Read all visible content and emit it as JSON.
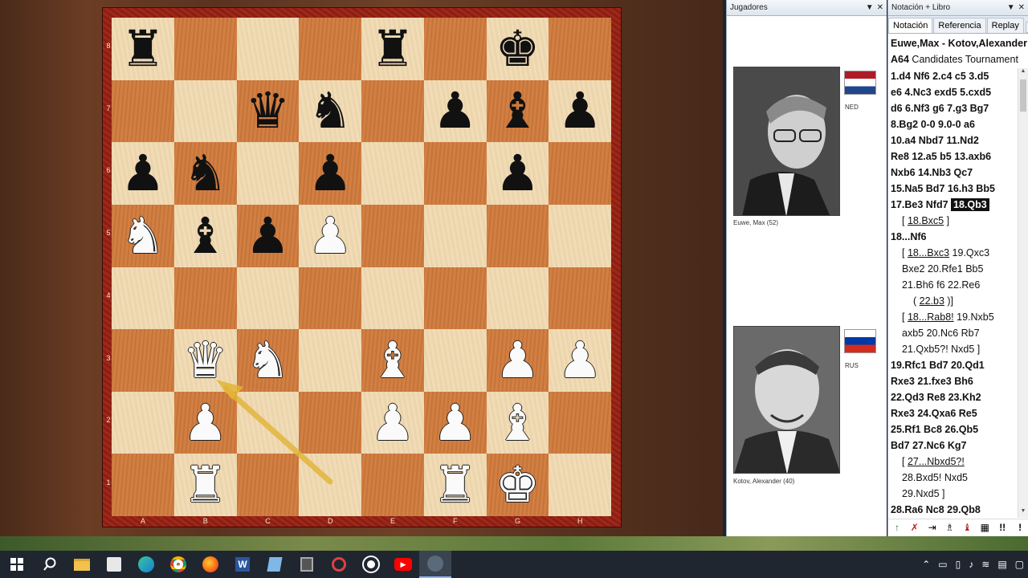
{
  "board": {
    "ranks": [
      "8",
      "7",
      "6",
      "5",
      "4",
      "3",
      "2",
      "1"
    ],
    "files": [
      "A",
      "B",
      "C",
      "D",
      "E",
      "F",
      "G",
      "H"
    ],
    "position": [
      [
        "bR",
        "",
        "",
        "",
        "bR",
        "",
        "bK",
        ""
      ],
      [
        "",
        "",
        "bQ",
        "bN",
        "",
        "bP",
        "bB",
        "bP"
      ],
      [
        "bP",
        "bN",
        "",
        "bP",
        "",
        "",
        "bP",
        ""
      ],
      [
        "wN",
        "bB",
        "bP",
        "wP",
        "",
        "",
        "",
        ""
      ],
      [
        "",
        "",
        "",
        "",
        "",
        "",
        "",
        ""
      ],
      [
        "",
        "wQ",
        "wN",
        "",
        "wB",
        "",
        "wP",
        "wP"
      ],
      [
        "",
        "wP",
        "",
        "",
        "wP",
        "wP",
        "wB",
        ""
      ],
      [
        "",
        "wR",
        "",
        "",
        "",
        "wR",
        "wK",
        ""
      ]
    ],
    "arrow_color": "#e2b436"
  },
  "players_pane": {
    "title": "Jugadores",
    "white": {
      "name": "Euwe, Max  (52)",
      "country": "NED"
    },
    "black": {
      "name": "Kotov, Alexander  (40)",
      "country": "RUS"
    }
  },
  "notation_pane": {
    "title": "Notación + Libro",
    "tabs": [
      "Notación",
      "Referencia",
      "Replay"
    ],
    "header": {
      "players": "Euwe,Max - Kotov,Alexander",
      "eco": "A64",
      "event": "Candidates Tournament"
    },
    "lines": [
      {
        "cls": "main",
        "parts": [
          {
            "t": "1.d4  Nf6  2.c4  c5  3.d5"
          }
        ]
      },
      {
        "cls": "main",
        "parts": [
          {
            "t": "e6  4.Nc3  exd5  5.cxd5"
          }
        ]
      },
      {
        "cls": "main",
        "parts": [
          {
            "t": "d6  6.Nf3  g6  7.g3  Bg7"
          }
        ]
      },
      {
        "cls": "main",
        "parts": [
          {
            "t": "8.Bg2  0-0  9.0-0  a6"
          }
        ]
      },
      {
        "cls": "main",
        "parts": [
          {
            "t": "10.a4  Nbd7  11.Nd2"
          }
        ]
      },
      {
        "cls": "main",
        "parts": [
          {
            "t": "Re8  12.a5  b5  13.axb6"
          }
        ]
      },
      {
        "cls": "main",
        "parts": [
          {
            "t": "Nxb6  14.Nb3  Qc7"
          }
        ]
      },
      {
        "cls": "main",
        "parts": [
          {
            "t": "15.Na5  Bd7  16.h3  Bb5"
          }
        ]
      },
      {
        "cls": "main",
        "parts": [
          {
            "t": "17.Be3  Nfd7  "
          },
          {
            "t": "18.Qb3",
            "k": "cur"
          }
        ]
      },
      {
        "cls": "var",
        "parts": [
          {
            "t": "[ "
          },
          {
            "t": "18.Bxc5",
            "k": "u"
          },
          {
            "t": " ]"
          }
        ]
      },
      {
        "cls": "main",
        "parts": [
          {
            "t": "18...Nf6"
          }
        ]
      },
      {
        "cls": "var",
        "parts": [
          {
            "t": "[ "
          },
          {
            "t": "18...Bxc3",
            "k": "u"
          },
          {
            "t": "  19.Qxc3"
          }
        ]
      },
      {
        "cls": "var",
        "parts": [
          {
            "t": "Bxe2  20.Rfe1  Bb5"
          }
        ]
      },
      {
        "cls": "var",
        "parts": [
          {
            "t": "21.Bh6  f6  22.Re6"
          }
        ]
      },
      {
        "cls": "var2",
        "parts": [
          {
            "t": "( "
          },
          {
            "t": "22.b3",
            "k": "u"
          },
          {
            "t": " )]"
          }
        ]
      },
      {
        "cls": "var",
        "parts": [
          {
            "t": "[ "
          },
          {
            "t": "18...Rab8!",
            "k": "u"
          },
          {
            "t": "  19.Nxb5"
          }
        ]
      },
      {
        "cls": "var",
        "parts": [
          {
            "t": "axb5  20.Nc6  Rb7"
          }
        ]
      },
      {
        "cls": "var",
        "parts": [
          {
            "t": "21.Qxb5?!  Nxd5 ]"
          }
        ]
      },
      {
        "cls": "main",
        "parts": [
          {
            "t": "19.Rfc1  Bd7  20.Qd1"
          }
        ]
      },
      {
        "cls": "main",
        "parts": [
          {
            "t": "Rxe3  21.fxe3  Bh6"
          }
        ]
      },
      {
        "cls": "main",
        "parts": [
          {
            "t": "22.Qd3  Re8  23.Kh2"
          }
        ]
      },
      {
        "cls": "main",
        "parts": [
          {
            "t": "Rxe3  24.Qxa6  Re5"
          }
        ]
      },
      {
        "cls": "main",
        "parts": [
          {
            "t": "25.Rf1  Bc8  26.Qb5"
          }
        ]
      },
      {
        "cls": "main",
        "parts": [
          {
            "t": "Bd7  27.Nc6  Kg7"
          }
        ]
      },
      {
        "cls": "var",
        "parts": [
          {
            "t": "[ "
          },
          {
            "t": "27...Nbxd5?!",
            "k": "u"
          }
        ]
      },
      {
        "cls": "var",
        "parts": [
          {
            "t": "28.Bxd5!  Nxd5"
          }
        ]
      },
      {
        "cls": "var",
        "parts": [
          {
            "t": "29.Nxd5 ]"
          }
        ]
      },
      {
        "cls": "main",
        "parts": [
          {
            "t": "28.Ra6  Nc8  29.Qb8"
          }
        ]
      }
    ],
    "toolbar": [
      "!!",
      "!"
    ]
  }
}
